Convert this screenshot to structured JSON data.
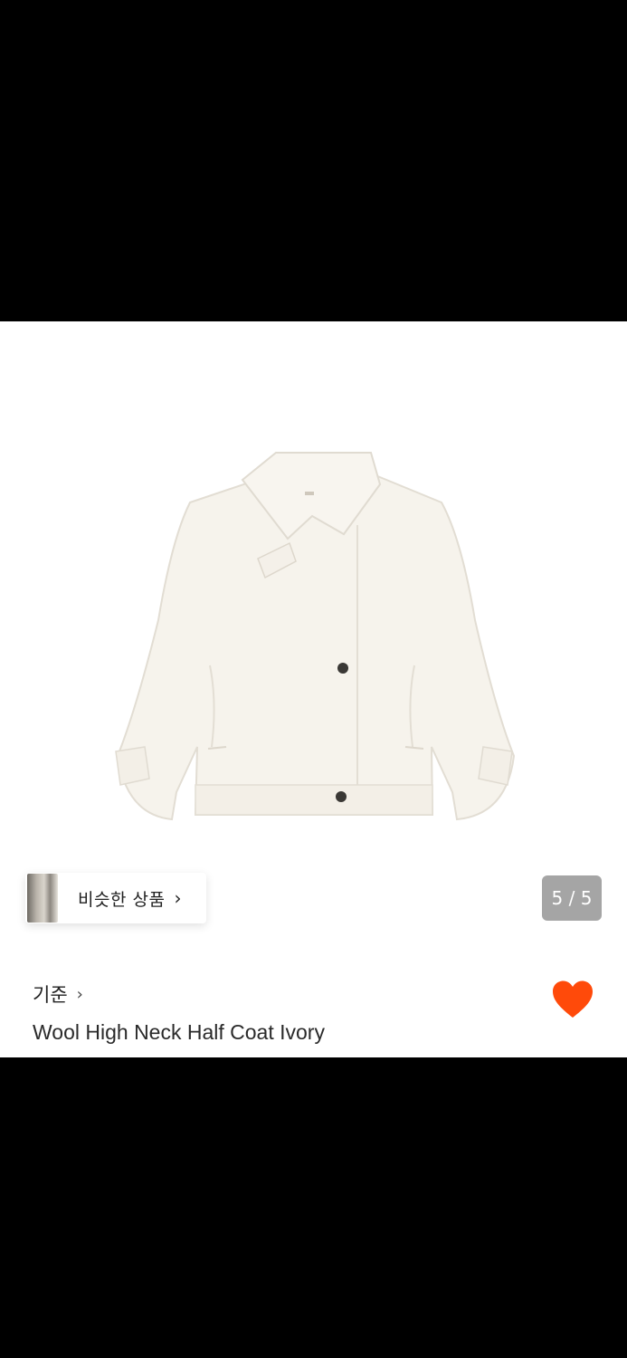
{
  "product": {
    "image_alt": "ivory wool high neck half coat",
    "brand": "기준",
    "brand_chevron": "›",
    "title": "Wool High Neck Half Coat Ivory"
  },
  "similar": {
    "label": "비슷한 상품",
    "chevron": "›"
  },
  "gallery": {
    "counter": "5 / 5"
  },
  "wishlist": {
    "liked": true,
    "color": "#ff4a0a"
  }
}
